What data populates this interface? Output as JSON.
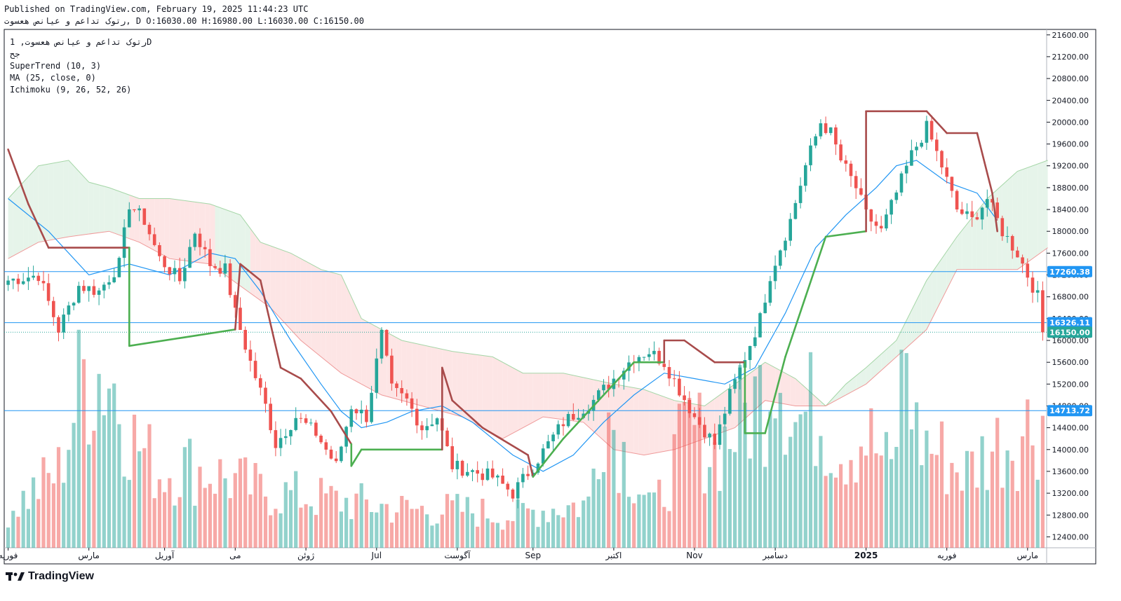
{
  "header": {
    "published": "Published on TradingView.com, February 19, 2025 11:44:23 UTC",
    "ohlc_line": "رتوک تداعم و عیانص هعسوت, D O:16030.00 H:16980.00 L:16030.00 C:16150.00"
  },
  "legend": {
    "symbol": "رتوک تداعم و عیانص هعسوت, 1D",
    "exchange": "جح",
    "indicators": [
      "SuperTrend (10, 3)",
      "MA (25, close, 0)",
      "Ichimoku (9, 26, 52, 26)"
    ]
  },
  "brand": {
    "name": "TradingView"
  },
  "colors": {
    "up": "#26a69a",
    "down": "#ef5350",
    "supertrend_up": "#4caf50",
    "supertrend_down": "#a84b4b",
    "ma": "#2196f3",
    "cloud_bull": "#e6f4ea",
    "cloud_bear": "#fde5e5",
    "level_line": "#2196f3"
  },
  "chart_data": {
    "type": "candlestick",
    "y_axis": {
      "range": [
        12200,
        21700
      ],
      "ticks": [
        12400,
        12800,
        13200,
        13600,
        14000,
        14400,
        14800,
        15200,
        15600,
        16000,
        16400,
        16800,
        17200,
        17600,
        18000,
        18400,
        18800,
        19200,
        19600,
        20000,
        20400,
        20800,
        21200,
        21600
      ],
      "tick_labels": [
        "12400.00",
        "12800.00",
        "13200.00",
        "13600.00",
        "14000.00",
        "14400.00",
        "14800.00",
        "15200.00",
        "15600.00",
        "16000.00",
        "16400.00",
        "16800.00",
        "17200.00",
        "17600.00",
        "18000.00",
        "18400.00",
        "18800.00",
        "19200.00",
        "19600.00",
        "20000.00",
        "20400.00",
        "20800.00",
        "21200.00",
        "21600.00"
      ]
    },
    "x_axis": {
      "labels": [
        "فوریه",
        "مارس",
        "آوریل",
        "می",
        "ژوئن",
        "Jul",
        "آگوست",
        "Sep",
        "اکتبر",
        "Nov",
        "دسامبر",
        "2025",
        "فوریه",
        "مارس"
      ],
      "label_index": [
        0,
        16,
        31,
        45,
        59,
        73,
        89,
        104,
        120,
        136,
        152,
        170,
        186,
        202
      ]
    },
    "levels": [
      {
        "value": 17260.38,
        "label": "17260.38"
      },
      {
        "value": 16326.11,
        "label": "16326.11"
      },
      {
        "value": 16150.0,
        "label": "16150.00"
      },
      {
        "value": 14713.72,
        "label": "14713.72"
      }
    ],
    "price_path": [
      [
        0,
        17100
      ],
      [
        6,
        17200
      ],
      [
        10,
        16200
      ],
      [
        14,
        17000
      ],
      [
        18,
        16900
      ],
      [
        22,
        17400
      ],
      [
        24,
        18500
      ],
      [
        27,
        18200
      ],
      [
        30,
        17500
      ],
      [
        34,
        17100
      ],
      [
        37,
        18000
      ],
      [
        40,
        17400
      ],
      [
        43,
        17300
      ],
      [
        45,
        16500
      ],
      [
        48,
        15600
      ],
      [
        51,
        14800
      ],
      [
        53,
        14100
      ],
      [
        57,
        14600
      ],
      [
        61,
        14300
      ],
      [
        65,
        13700
      ],
      [
        68,
        14800
      ],
      [
        71,
        14600
      ],
      [
        74,
        16100
      ],
      [
        76,
        15100
      ],
      [
        79,
        14900
      ],
      [
        82,
        14400
      ],
      [
        85,
        14600
      ],
      [
        88,
        13700
      ],
      [
        92,
        13600
      ],
      [
        96,
        13500
      ],
      [
        100,
        13200
      ],
      [
        104,
        13700
      ],
      [
        110,
        14500
      ],
      [
        116,
        14900
      ],
      [
        120,
        15300
      ],
      [
        124,
        15700
      ],
      [
        127,
        15800
      ],
      [
        130,
        15600
      ],
      [
        133,
        15100
      ],
      [
        136,
        14600
      ],
      [
        140,
        14100
      ],
      [
        143,
        15000
      ],
      [
        146,
        15700
      ],
      [
        149,
        16400
      ],
      [
        151,
        17200
      ],
      [
        153,
        17700
      ],
      [
        155,
        18200
      ],
      [
        158,
        19200
      ],
      [
        161,
        20000
      ],
      [
        163,
        19800
      ],
      [
        165,
        19300
      ],
      [
        168,
        18800
      ],
      [
        170,
        18300
      ],
      [
        173,
        18000
      ],
      [
        176,
        18700
      ],
      [
        179,
        19400
      ],
      [
        182,
        19900
      ],
      [
        185,
        19200
      ],
      [
        188,
        18400
      ],
      [
        191,
        18200
      ],
      [
        194,
        18600
      ],
      [
        197,
        18000
      ],
      [
        200,
        17600
      ],
      [
        202,
        17200
      ],
      [
        204,
        16800
      ],
      [
        205,
        16150
      ]
    ],
    "volume_path": [
      [
        0,
        60
      ],
      [
        10,
        120
      ],
      [
        15,
        280
      ],
      [
        20,
        280
      ],
      [
        25,
        170
      ],
      [
        30,
        120
      ],
      [
        35,
        130
      ],
      [
        40,
        120
      ],
      [
        50,
        90
      ],
      [
        60,
        80
      ],
      [
        70,
        70
      ],
      [
        80,
        60
      ],
      [
        90,
        60
      ],
      [
        100,
        50
      ],
      [
        105,
        60
      ],
      [
        115,
        70
      ],
      [
        118,
        240
      ],
      [
        122,
        150
      ],
      [
        128,
        60
      ],
      [
        135,
        190
      ],
      [
        140,
        150
      ],
      [
        150,
        250
      ],
      [
        152,
        330
      ],
      [
        156,
        200
      ],
      [
        160,
        220
      ],
      [
        165,
        160
      ],
      [
        170,
        180
      ],
      [
        175,
        120
      ],
      [
        178,
        320
      ],
      [
        180,
        180
      ],
      [
        186,
        140
      ],
      [
        190,
        120
      ],
      [
        195,
        160
      ],
      [
        200,
        180
      ],
      [
        205,
        210
      ]
    ],
    "supertrend": [
      [
        0,
        19500
      ],
      [
        4,
        18500
      ],
      [
        8,
        17700
      ],
      [
        24,
        17700
      ],
      [
        24,
        15900
      ],
      [
        45,
        16200
      ],
      [
        46,
        17400
      ],
      [
        50,
        17100
      ],
      [
        54,
        15500
      ],
      [
        58,
        15300
      ],
      [
        64,
        14700
      ],
      [
        68,
        14100
      ],
      [
        68,
        13700
      ],
      [
        70,
        14000
      ],
      [
        86,
        14000
      ],
      [
        86,
        15500
      ],
      [
        88,
        14900
      ],
      [
        94,
        14400
      ],
      [
        103,
        13900
      ],
      [
        104,
        13500
      ],
      [
        110,
        14200
      ],
      [
        116,
        14800
      ],
      [
        124,
        15600
      ],
      [
        130,
        15600
      ],
      [
        130,
        16000
      ],
      [
        134,
        16000
      ],
      [
        140,
        15600
      ],
      [
        146,
        15600
      ],
      [
        146,
        14300
      ],
      [
        150,
        14300
      ],
      [
        154,
        15700
      ],
      [
        158,
        16800
      ],
      [
        162,
        17900
      ],
      [
        170,
        18000
      ],
      [
        170,
        20200
      ],
      [
        182,
        20200
      ],
      [
        186,
        19800
      ],
      [
        192,
        19800
      ],
      [
        195,
        18700
      ],
      [
        196,
        18000
      ]
    ],
    "ma25": [
      [
        0,
        18600
      ],
      [
        8,
        18000
      ],
      [
        16,
        17200
      ],
      [
        24,
        17400
      ],
      [
        32,
        17200
      ],
      [
        40,
        17600
      ],
      [
        45,
        17500
      ],
      [
        50,
        16900
      ],
      [
        56,
        16000
      ],
      [
        62,
        15200
      ],
      [
        66,
        14700
      ],
      [
        70,
        14400
      ],
      [
        75,
        14500
      ],
      [
        80,
        14700
      ],
      [
        86,
        14800
      ],
      [
        92,
        14500
      ],
      [
        100,
        13900
      ],
      [
        106,
        13600
      ],
      [
        112,
        13900
      ],
      [
        118,
        14500
      ],
      [
        124,
        15000
      ],
      [
        130,
        15400
      ],
      [
        136,
        15300
      ],
      [
        142,
        15200
      ],
      [
        148,
        15500
      ],
      [
        154,
        16500
      ],
      [
        160,
        17700
      ],
      [
        166,
        18300
      ],
      [
        172,
        18800
      ],
      [
        176,
        19200
      ],
      [
        180,
        19300
      ],
      [
        186,
        18900
      ],
      [
        192,
        18700
      ],
      [
        196,
        18200
      ]
    ],
    "cloud_upper": [
      [
        0,
        18600
      ],
      [
        6,
        19200
      ],
      [
        12,
        19300
      ],
      [
        16,
        18900
      ],
      [
        20,
        18800
      ],
      [
        26,
        18600
      ],
      [
        32,
        18600
      ],
      [
        40,
        18500
      ],
      [
        46,
        18300
      ],
      [
        50,
        17800
      ],
      [
        56,
        17600
      ],
      [
        62,
        17300
      ],
      [
        66,
        17200
      ],
      [
        70,
        16400
      ],
      [
        78,
        16000
      ],
      [
        88,
        15800
      ],
      [
        96,
        15700
      ],
      [
        102,
        15400
      ],
      [
        110,
        15400
      ],
      [
        120,
        15200
      ],
      [
        126,
        15100
      ],
      [
        132,
        14900
      ],
      [
        138,
        14800
      ],
      [
        144,
        15200
      ],
      [
        150,
        15600
      ],
      [
        156,
        15300
      ],
      [
        162,
        14800
      ],
      [
        166,
        15200
      ],
      [
        170,
        15500
      ],
      [
        176,
        16000
      ],
      [
        182,
        17100
      ],
      [
        188,
        17900
      ],
      [
        194,
        18600
      ],
      [
        200,
        19100
      ],
      [
        206,
        19300
      ]
    ],
    "cloud_lower": [
      [
        0,
        17500
      ],
      [
        6,
        17800
      ],
      [
        12,
        17900
      ],
      [
        20,
        18000
      ],
      [
        26,
        17800
      ],
      [
        32,
        17500
      ],
      [
        40,
        17400
      ],
      [
        46,
        17000
      ],
      [
        52,
        16600
      ],
      [
        58,
        16000
      ],
      [
        66,
        15400
      ],
      [
        74,
        15000
      ],
      [
        82,
        14800
      ],
      [
        90,
        14600
      ],
      [
        98,
        14200
      ],
      [
        106,
        14600
      ],
      [
        114,
        14500
      ],
      [
        120,
        14000
      ],
      [
        126,
        13900
      ],
      [
        132,
        14000
      ],
      [
        138,
        14200
      ],
      [
        144,
        14400
      ],
      [
        150,
        14900
      ],
      [
        156,
        14800
      ],
      [
        162,
        14800
      ],
      [
        166,
        15000
      ],
      [
        170,
        15200
      ],
      [
        176,
        15700
      ],
      [
        182,
        16200
      ],
      [
        188,
        17300
      ],
      [
        194,
        17300
      ],
      [
        200,
        17300
      ],
      [
        206,
        17700
      ]
    ]
  }
}
